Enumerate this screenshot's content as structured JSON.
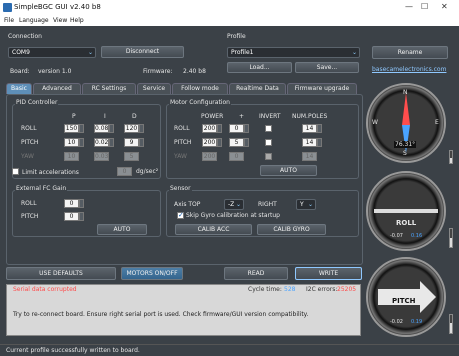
{
  "window": {
    "title": "SimpleBGC GUI v2.40 b8",
    "min": "—",
    "max": "☐",
    "close": "✕"
  },
  "menu": [
    "File",
    "Language",
    "View",
    "Help"
  ],
  "connection": {
    "title": "Connection",
    "port": "COM9",
    "disconnect": "Disconnect",
    "board_label": "Board:",
    "board": "version 1.0",
    "fw_label": "Firmware:",
    "fw": "2.40 b8"
  },
  "profile": {
    "title": "Profile",
    "value": "Profile1",
    "rename": "Rename",
    "load": "Load...",
    "save": "Save...",
    "link": "basecamelectronics.com"
  },
  "tabs": [
    "Basic",
    "Advanced",
    "RC Settings",
    "Service",
    "Follow mode",
    "Realtime Data",
    "Firmware upgrade"
  ],
  "pid": {
    "title": "PID Controller",
    "cols": [
      "P",
      "I",
      "D"
    ],
    "rows": [
      {
        "label": "ROLL",
        "p": "150",
        "i": "0.08",
        "d": "120"
      },
      {
        "label": "PITCH",
        "p": "10",
        "i": "0.02",
        "d": "9"
      },
      {
        "label": "YAW",
        "p": "10",
        "i": "0.03",
        "d": "5"
      }
    ],
    "limit": "Limit accelerations",
    "limit_val": "0",
    "limit_unit": "dg/sec²"
  },
  "motor": {
    "title": "Motor Configuration",
    "cols": [
      "POWER",
      "+",
      "INVERT",
      "NUM.POLES"
    ],
    "rows": [
      {
        "label": "ROLL",
        "power": "200",
        "plus": "0",
        "poles": "14"
      },
      {
        "label": "PITCH",
        "power": "200",
        "plus": "5",
        "poles": "14"
      },
      {
        "label": "YAW",
        "power": "200",
        "plus": "0",
        "poles": "14"
      }
    ],
    "auto": "AUTO"
  },
  "ext": {
    "title": "External FC Gain",
    "roll": "ROLL",
    "roll_val": "0",
    "pitch": "PITCH",
    "pitch_val": "0",
    "auto": "AUTO"
  },
  "sensor": {
    "title": "Sensor",
    "axis_top": "Axis TOP",
    "axis_top_val": "-Z",
    "right": "RIGHT",
    "right_val": "Y",
    "skip_gyro": "Skip Gyro calibration at startup",
    "calib_acc": "CALIB ACC",
    "calib_gyro": "CALIB GYRO"
  },
  "bottom": {
    "use_defaults": "USE DEFAULTS",
    "motors": "MOTORS ON/OFF",
    "read": "READ",
    "write": "WRITE"
  },
  "log": {
    "error": "Serial data corrupted",
    "cycle_label": "Cycle time:",
    "cycle_val": "528",
    "i2c_label": "I2C errors:",
    "i2c_val": "25205",
    "message": "Try to re-connect board. Ensure right serial port is used. Check firmware/GUI version compatibility."
  },
  "status": "Current profile successfully written to board.",
  "gauges": {
    "yaw": {
      "value": "76.31°",
      "n": "N",
      "s": "S",
      "e": "E",
      "w": "W"
    },
    "roll": {
      "label": "ROLL",
      "a": "-0.07",
      "b": "0.16"
    },
    "pitch": {
      "label": "PITCH",
      "a": "-0.02",
      "b": "0.19"
    }
  },
  "colors": {
    "accent": "#5e8fb8",
    "error": "#ff4a4a",
    "cycle": "#4aa3ff"
  }
}
